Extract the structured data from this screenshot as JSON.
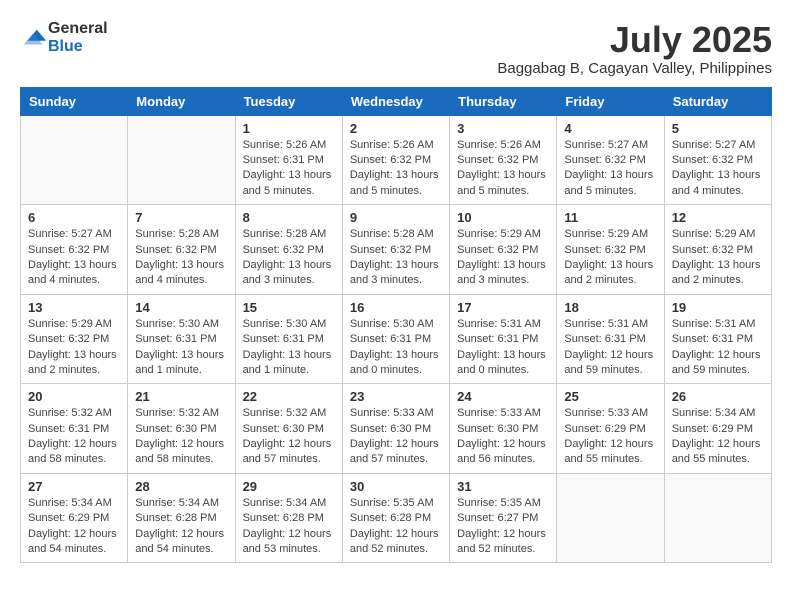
{
  "logo": {
    "general": "General",
    "blue": "Blue"
  },
  "title": "July 2025",
  "location": "Baggabag B, Cagayan Valley, Philippines",
  "days_of_week": [
    "Sunday",
    "Monday",
    "Tuesday",
    "Wednesday",
    "Thursday",
    "Friday",
    "Saturday"
  ],
  "weeks": [
    [
      {
        "day": "",
        "info": ""
      },
      {
        "day": "",
        "info": ""
      },
      {
        "day": "1",
        "info": "Sunrise: 5:26 AM\nSunset: 6:31 PM\nDaylight: 13 hours and 5 minutes."
      },
      {
        "day": "2",
        "info": "Sunrise: 5:26 AM\nSunset: 6:32 PM\nDaylight: 13 hours and 5 minutes."
      },
      {
        "day": "3",
        "info": "Sunrise: 5:26 AM\nSunset: 6:32 PM\nDaylight: 13 hours and 5 minutes."
      },
      {
        "day": "4",
        "info": "Sunrise: 5:27 AM\nSunset: 6:32 PM\nDaylight: 13 hours and 5 minutes."
      },
      {
        "day": "5",
        "info": "Sunrise: 5:27 AM\nSunset: 6:32 PM\nDaylight: 13 hours and 4 minutes."
      }
    ],
    [
      {
        "day": "6",
        "info": "Sunrise: 5:27 AM\nSunset: 6:32 PM\nDaylight: 13 hours and 4 minutes."
      },
      {
        "day": "7",
        "info": "Sunrise: 5:28 AM\nSunset: 6:32 PM\nDaylight: 13 hours and 4 minutes."
      },
      {
        "day": "8",
        "info": "Sunrise: 5:28 AM\nSunset: 6:32 PM\nDaylight: 13 hours and 3 minutes."
      },
      {
        "day": "9",
        "info": "Sunrise: 5:28 AM\nSunset: 6:32 PM\nDaylight: 13 hours and 3 minutes."
      },
      {
        "day": "10",
        "info": "Sunrise: 5:29 AM\nSunset: 6:32 PM\nDaylight: 13 hours and 3 minutes."
      },
      {
        "day": "11",
        "info": "Sunrise: 5:29 AM\nSunset: 6:32 PM\nDaylight: 13 hours and 2 minutes."
      },
      {
        "day": "12",
        "info": "Sunrise: 5:29 AM\nSunset: 6:32 PM\nDaylight: 13 hours and 2 minutes."
      }
    ],
    [
      {
        "day": "13",
        "info": "Sunrise: 5:29 AM\nSunset: 6:32 PM\nDaylight: 13 hours and 2 minutes."
      },
      {
        "day": "14",
        "info": "Sunrise: 5:30 AM\nSunset: 6:31 PM\nDaylight: 13 hours and 1 minute."
      },
      {
        "day": "15",
        "info": "Sunrise: 5:30 AM\nSunset: 6:31 PM\nDaylight: 13 hours and 1 minute."
      },
      {
        "day": "16",
        "info": "Sunrise: 5:30 AM\nSunset: 6:31 PM\nDaylight: 13 hours and 0 minutes."
      },
      {
        "day": "17",
        "info": "Sunrise: 5:31 AM\nSunset: 6:31 PM\nDaylight: 13 hours and 0 minutes."
      },
      {
        "day": "18",
        "info": "Sunrise: 5:31 AM\nSunset: 6:31 PM\nDaylight: 12 hours and 59 minutes."
      },
      {
        "day": "19",
        "info": "Sunrise: 5:31 AM\nSunset: 6:31 PM\nDaylight: 12 hours and 59 minutes."
      }
    ],
    [
      {
        "day": "20",
        "info": "Sunrise: 5:32 AM\nSunset: 6:31 PM\nDaylight: 12 hours and 58 minutes."
      },
      {
        "day": "21",
        "info": "Sunrise: 5:32 AM\nSunset: 6:30 PM\nDaylight: 12 hours and 58 minutes."
      },
      {
        "day": "22",
        "info": "Sunrise: 5:32 AM\nSunset: 6:30 PM\nDaylight: 12 hours and 57 minutes."
      },
      {
        "day": "23",
        "info": "Sunrise: 5:33 AM\nSunset: 6:30 PM\nDaylight: 12 hours and 57 minutes."
      },
      {
        "day": "24",
        "info": "Sunrise: 5:33 AM\nSunset: 6:30 PM\nDaylight: 12 hours and 56 minutes."
      },
      {
        "day": "25",
        "info": "Sunrise: 5:33 AM\nSunset: 6:29 PM\nDaylight: 12 hours and 55 minutes."
      },
      {
        "day": "26",
        "info": "Sunrise: 5:34 AM\nSunset: 6:29 PM\nDaylight: 12 hours and 55 minutes."
      }
    ],
    [
      {
        "day": "27",
        "info": "Sunrise: 5:34 AM\nSunset: 6:29 PM\nDaylight: 12 hours and 54 minutes."
      },
      {
        "day": "28",
        "info": "Sunrise: 5:34 AM\nSunset: 6:28 PM\nDaylight: 12 hours and 54 minutes."
      },
      {
        "day": "29",
        "info": "Sunrise: 5:34 AM\nSunset: 6:28 PM\nDaylight: 12 hours and 53 minutes."
      },
      {
        "day": "30",
        "info": "Sunrise: 5:35 AM\nSunset: 6:28 PM\nDaylight: 12 hours and 52 minutes."
      },
      {
        "day": "31",
        "info": "Sunrise: 5:35 AM\nSunset: 6:27 PM\nDaylight: 12 hours and 52 minutes."
      },
      {
        "day": "",
        "info": ""
      },
      {
        "day": "",
        "info": ""
      }
    ]
  ]
}
